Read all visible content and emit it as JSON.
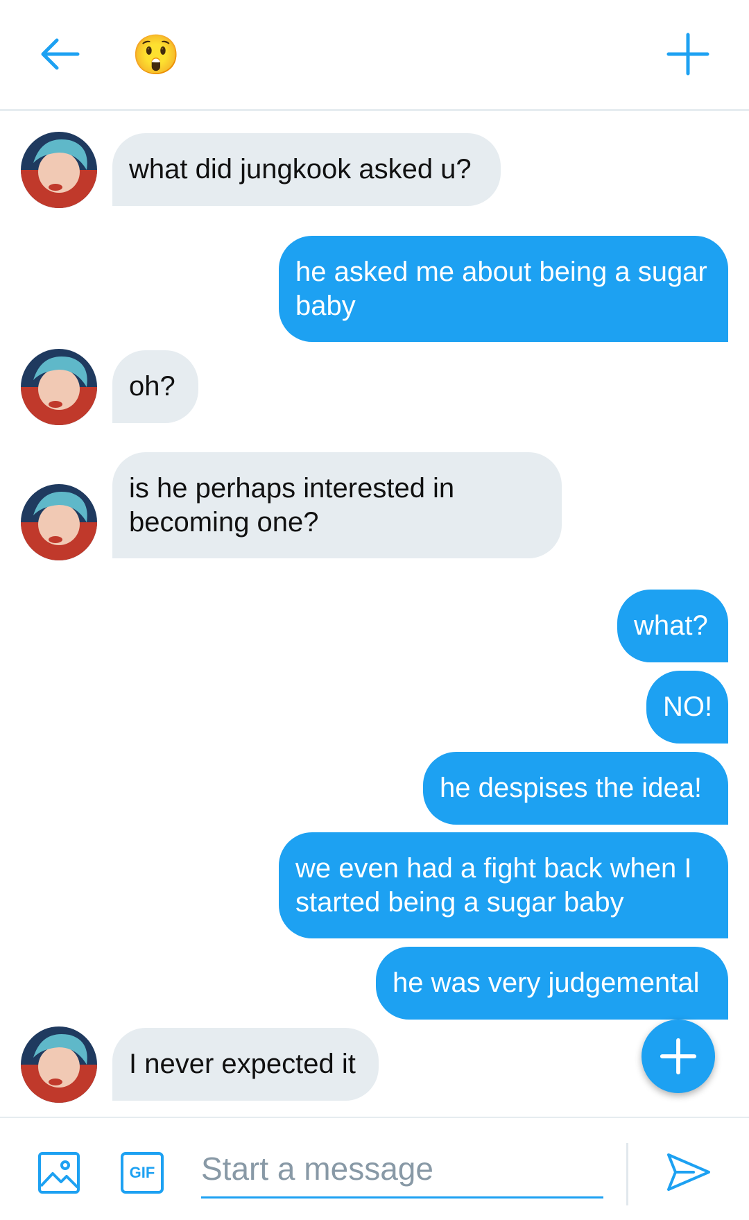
{
  "header": {
    "back_icon": "arrow-left-icon",
    "title_emoji": "😲",
    "add_icon": "plus-icon"
  },
  "colors": {
    "accent": "#1da1f2",
    "incoming_bubble": "#e6ecf0",
    "placeholder": "#8899a6"
  },
  "messages": [
    {
      "direction": "in",
      "text": "what did jungkook asked u?"
    },
    {
      "direction": "out",
      "text": "he asked me about being a sugar baby"
    },
    {
      "direction": "in",
      "text": "oh?"
    },
    {
      "direction": "in",
      "text": "is he perhaps interested in becoming one?"
    },
    {
      "direction": "out",
      "text": "what?"
    },
    {
      "direction": "out",
      "text": "NO!"
    },
    {
      "direction": "out",
      "text": "he despises the idea!"
    },
    {
      "direction": "out",
      "text": "we even had a fight back when I started being a sugar baby"
    },
    {
      "direction": "out",
      "text": "he was very judgemental"
    },
    {
      "direction": "in",
      "text": "I never expected it"
    }
  ],
  "composer": {
    "image_icon": "image-icon",
    "gif_label": "GIF",
    "placeholder": "Start a message",
    "value": "",
    "send_icon": "send-icon"
  },
  "fab_icon": "plus-icon"
}
